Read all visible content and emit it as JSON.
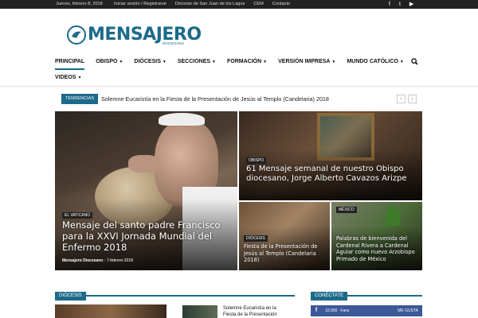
{
  "topbar": {
    "date": "Jueves, febrero 8, 2018",
    "links": [
      "Iniciar sesión / Registrarse",
      "Diócesis de San Juan de los Lagos",
      "CEM",
      "Contacto"
    ],
    "social": [
      "f",
      "t",
      "▶"
    ]
  },
  "logo": {
    "word": "MENSAJERO",
    "sub": "DIOCESANO"
  },
  "nav": {
    "row1": [
      "PRINCIPAL",
      "OBISPO",
      "DIÓCESIS",
      "SECCIONES",
      "FORMACIÓN",
      "VERSIÓN IMPRESA",
      "MUNDO CATÓLICO"
    ],
    "row2": [
      "VIDEOS"
    ],
    "search_icon": "search-icon"
  },
  "ticker": {
    "tag": "TENDENCIAS",
    "headline": "Solemne Eucaristía en la Fiesta de la Presentación de Jesús al Templo (Candelaria) 2018",
    "prev": "‹",
    "next": "›"
  },
  "featured": {
    "main": {
      "category": "EL VATICANO",
      "title": "Mensaje del santo padre Francisco para la XXVI Jornada Mundial del Enfermo 2018",
      "author": "Mensajero Diocesano",
      "date": "7-febrero-2018"
    },
    "top_right": {
      "category": "OBISPO",
      "title": "61 Mensaje semanal de nuestro Obispo diocesano, Jorge Alberto Cavazos Arizpe"
    },
    "bottom_left": {
      "category": "DIÓCESIS",
      "title": "Fiesta de la Presentación de Jesús al Templo (Candelaria 2018)"
    },
    "bottom_right": {
      "category": "MÉXICO",
      "title": "Palabras de bienvenida del Cardenal Rivera a Cardenal Aguiar como nuevo Arzobispo Primado de México"
    }
  },
  "sections": {
    "left": "DIÓCESIS",
    "right": "CONÉCTATE",
    "side_article": "Solemne Eucaristía en la Fiesta de la Presentación"
  },
  "facebook": {
    "count": "10,900",
    "label": "Fans",
    "like": "ME GUSTA"
  }
}
